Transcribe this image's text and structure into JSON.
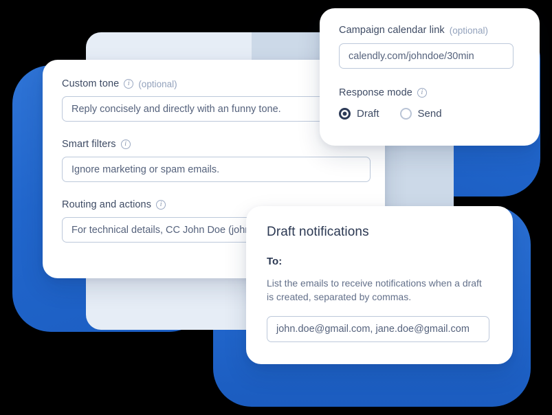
{
  "colors": {
    "background": "#000000",
    "blob_blue": "#2166cc",
    "pale_panel_light": "#e6edf6",
    "pale_panel_dark": "#ccd9e8",
    "card_white": "#ffffff",
    "label_text": "#3d4a63",
    "muted_text": "#93a2bc",
    "field_border": "#bcc8da",
    "radio_selected": "#2c3a57"
  },
  "main_card": {
    "fields": [
      {
        "label": "Custom tone",
        "info_icon": "info-circle-icon",
        "optional": "(optional)",
        "value": "Reply concisely and directly with an funny tone."
      },
      {
        "label": "Smart filters",
        "info_icon": "info-circle-icon",
        "optional": "",
        "value": "Ignore marketing or spam emails."
      },
      {
        "label": "Routing and actions",
        "info_icon": "info-circle-icon",
        "optional": "",
        "value": "For technical details, CC John Doe (john.doe@gmail.com)"
      }
    ]
  },
  "calendar_card": {
    "link_label": "Campaign calendar link",
    "link_info_icon": "",
    "link_optional": "(optional)",
    "link_value": "calendly.com/johndoe/30min",
    "mode_label": "Response mode",
    "mode_info_icon": "info-circle-icon",
    "options": [
      {
        "label": "Draft",
        "selected": true
      },
      {
        "label": "Send",
        "selected": false
      }
    ]
  },
  "notifications_card": {
    "title": "Draft notifications",
    "to_label": "To:",
    "description": "List the emails to receive notifications when a draft is created, separated by commas.",
    "emails_value": "john.doe@gmail.com, jane.doe@gmail.com"
  }
}
